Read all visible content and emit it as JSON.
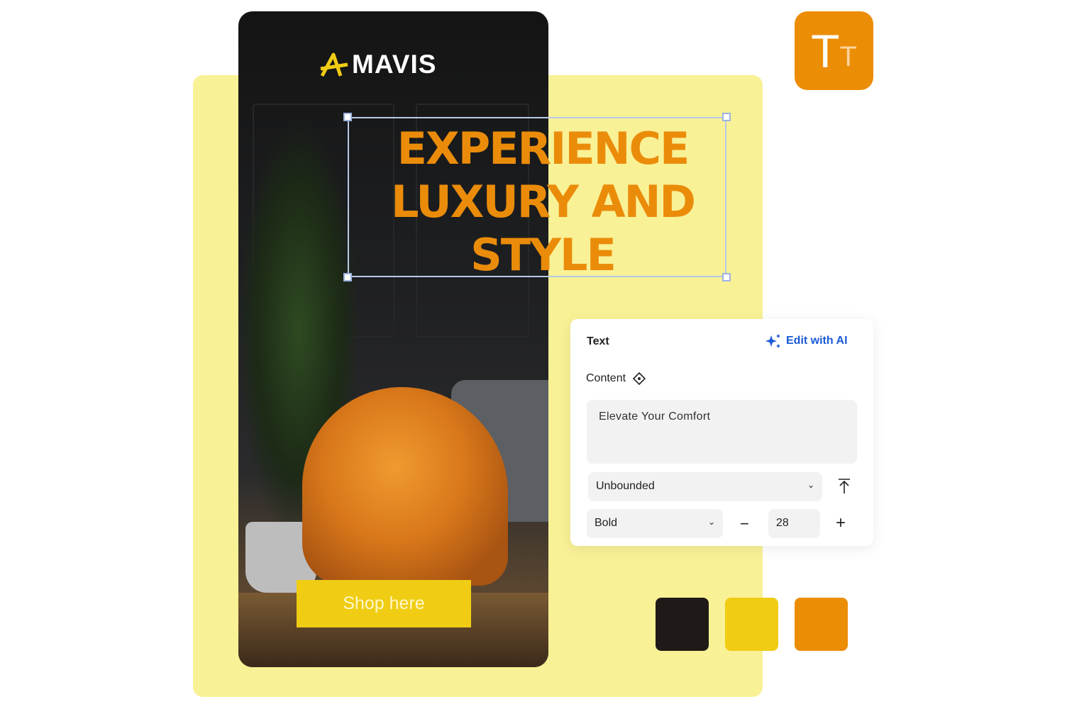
{
  "brand": {
    "name": "MAVIS"
  },
  "banner": {
    "headline": "EXPERIENCE LUXURY AND STYLE",
    "cta": "Shop here"
  },
  "text_tool_icon": {
    "label": "Tt",
    "color": "#ec8d06"
  },
  "panel": {
    "title": "Text",
    "edit_ai": "Edit with AI",
    "content_label": "Content",
    "content_value": "Elevate Your Comfort",
    "font_family": "Unbounded",
    "font_weight": "Bold",
    "font_size": "28"
  },
  "swatches": [
    "#1f1a17",
    "#f0cc14",
    "#ec8d06"
  ],
  "colors": {
    "accent": "#ea8c0a",
    "bg": "#f9f196",
    "link": "#1a5ad8"
  }
}
